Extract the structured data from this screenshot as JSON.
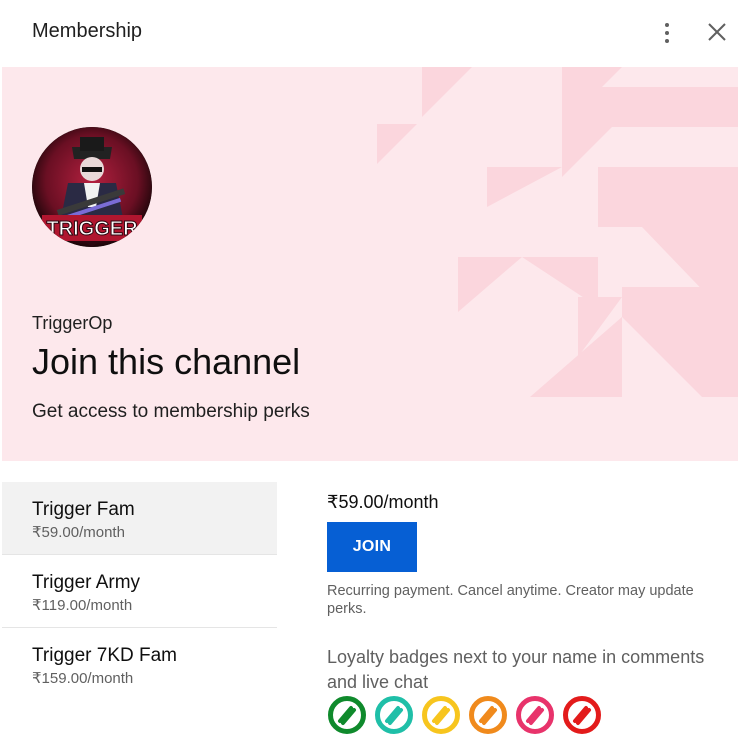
{
  "header": {
    "title": "Membership",
    "more_icon": "more-vert-icon",
    "close_icon": "close-icon"
  },
  "hero": {
    "background_color": "#fde8ec",
    "avatar_text": "TRIGGER",
    "channel_name": "TriggerOp",
    "heading": "Join this channel",
    "subheading": "Get access to membership perks"
  },
  "tiers": [
    {
      "name": "Trigger Fam",
      "price": "₹59.00/month",
      "selected": true
    },
    {
      "name": "Trigger Army",
      "price": "₹119.00/month",
      "selected": false
    },
    {
      "name": "Trigger 7KD Fam",
      "price": "₹159.00/month",
      "selected": false
    }
  ],
  "detail": {
    "price": "₹59.00/month",
    "join_label": "JOIN",
    "recurring_note": "Recurring payment. Cancel anytime. Creator may update perks.",
    "loyalty_text": "Loyalty badges next to your name in comments and live chat",
    "badge_colors": [
      "#0f8a2c",
      "#1fbfa8",
      "#f7c51e",
      "#f08a1c",
      "#e8336b",
      "#e31b1b"
    ]
  },
  "colors": {
    "accent": "#065fd4",
    "selected_tier_bg": "#f2f2f2"
  }
}
